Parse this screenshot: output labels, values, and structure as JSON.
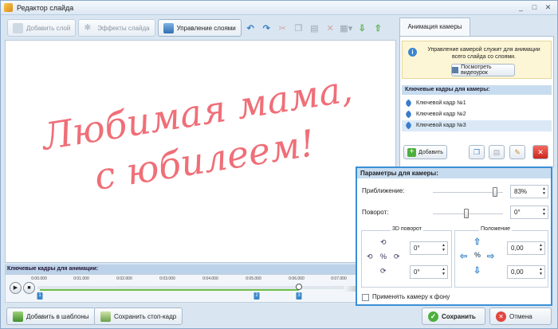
{
  "window": {
    "title": "Редактор слайда",
    "min": "_",
    "max": "□",
    "close": "✕"
  },
  "toolbar": {
    "add_layer": "Добавить слой",
    "effects": "Эффекты слайда",
    "manage_layers": "Управление слоями"
  },
  "canvas": {
    "line1": "Любимая мама,",
    "line2": "с юбилеем!",
    "text_color": "#ef6f78"
  },
  "timeline": {
    "header": "Ключевые кадры для анимации:",
    "ticks": [
      "0:00.000",
      "0:01.000",
      "0:02.000",
      "0:03.000",
      "0:04.000",
      "0:05.000",
      "0:06.000",
      "0:07.000"
    ],
    "keyframes": [
      "1",
      "2",
      "3"
    ]
  },
  "bottom": {
    "templates": "Добавить в шаблоны",
    "save_frame": "Сохранить стоп-кадр",
    "save": "Сохранить",
    "cancel": "Отмена"
  },
  "right": {
    "tab": "Анимация камеры",
    "info": "Управление камерой служит для анимации всего слайда со слоями.",
    "video_btn": "Посмотреть видеоурок",
    "kf_header": "Ключевые кадры для камеры:",
    "kf_items": [
      "Ключевой кадр №1",
      "Ключевой кадр №2",
      "Ключевой кадр №3"
    ],
    "add_btn": "Добавить"
  },
  "camera": {
    "header": "Параметры для камеры:",
    "zoom_label": "Приближение:",
    "zoom_value": "83%",
    "rotation_label": "Поворот:",
    "rotation_value": "0°",
    "rot3d_title": "3D поворот",
    "rot3d_x": "0°",
    "rot3d_y": "0°",
    "pos_title": "Положение",
    "pos_x": "0,00",
    "pos_y": "0,00",
    "apply_bg": "Применять камеру к фону"
  }
}
